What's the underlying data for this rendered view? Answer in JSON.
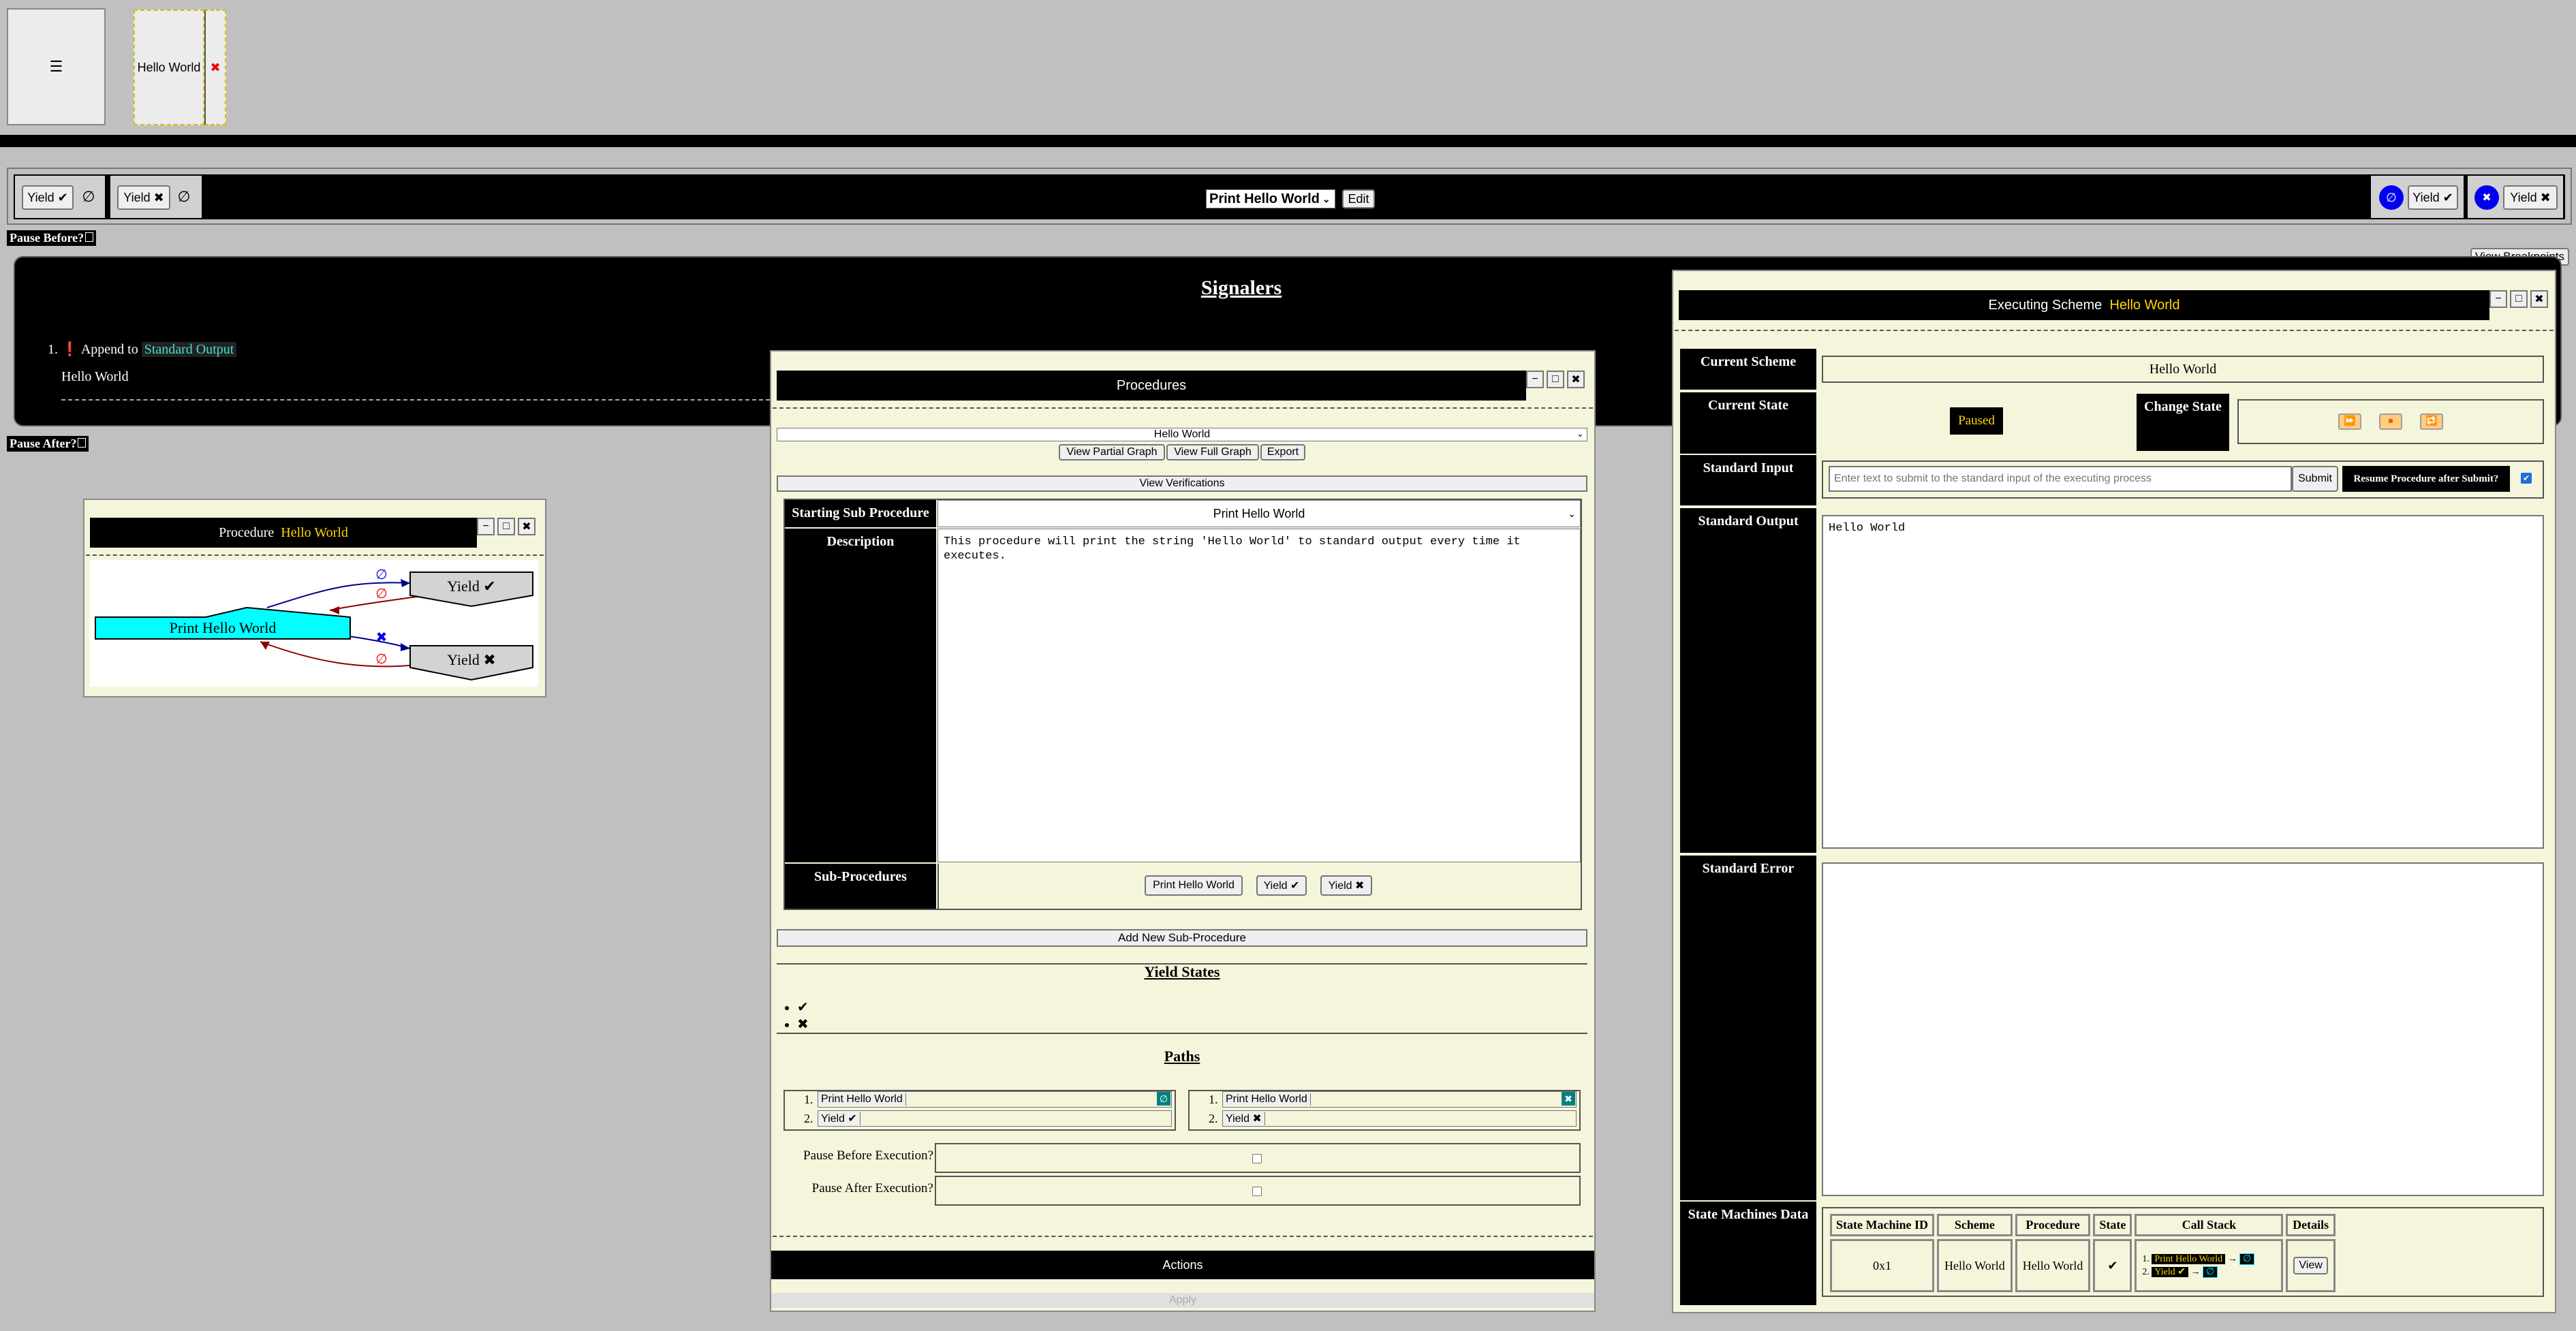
{
  "top": {
    "menu_icon": "☰",
    "tab_label": "Hello World",
    "tab_close": "✖"
  },
  "toolbar": {
    "left_items": [
      {
        "label": "Yield ✔",
        "icon": "∅"
      },
      {
        "label": "Yield ✖",
        "icon": "∅"
      }
    ],
    "procedure_select": "Print Hello World",
    "edit_label": "Edit",
    "right_items": [
      {
        "label": "Yield ✔",
        "icon": "∅"
      },
      {
        "label": "Yield ✖",
        "icon": "✖"
      }
    ]
  },
  "pause_before": "Pause Before?",
  "pause_after": "Pause After?",
  "view_breakpoints": "View Breakpoints",
  "signalers": {
    "title": "Signalers",
    "item_number": "1.",
    "item_marker": "❗",
    "item_prefix": "Append to",
    "item_target": "Standard Output",
    "item_text": "Hello World"
  },
  "procedure_window": {
    "title_prefix": "Procedure",
    "title_name": "Hello World",
    "graph": {
      "main_node": "Print Hello World",
      "yield_ok": "Yield ✔",
      "yield_err": "Yield ✖",
      "edge_null": "∅",
      "edge_err": "✖"
    }
  },
  "procedures_window": {
    "title": "Procedures",
    "scheme_select": "Hello World",
    "view_partial": "View Partial Graph",
    "view_full": "View Full Graph",
    "export": "Export",
    "view_verifications": "View Verifications",
    "starting_label": "Starting Sub Procedure",
    "starting_value": "Print Hello World",
    "description_label": "Description",
    "description_text": "This procedure will print the string 'Hello World' to standard output every time it executes.",
    "subprocedures_label": "Sub-Procedures",
    "subprocedures": [
      "Print Hello World",
      "Yield ✔",
      "Yield ✖"
    ],
    "add_subprocedure": "Add New Sub-Procedure",
    "yield_states_title": "Yield States",
    "yield_states": [
      "✔",
      "✖"
    ],
    "paths_title": "Paths",
    "path_left": {
      "row1": "Print Hello World",
      "row1_icon": "∅",
      "row2": "Yield ✔",
      "n1": "1.",
      "n2": "2."
    },
    "path_right": {
      "row1": "Print Hello World",
      "row1_icon": "✖",
      "row2": "Yield ✖",
      "n1": "1.",
      "n2": "2."
    },
    "pause_before_exec": "Pause Before Execution?",
    "pause_after_exec": "Pause After Execution?",
    "actions": "Actions",
    "apply": "Apply"
  },
  "executing_window": {
    "title_prefix": "Executing Scheme",
    "title_name": "Hello World",
    "current_scheme_label": "Current Scheme",
    "current_scheme_value": "Hello World",
    "current_state_label": "Current State",
    "state_value": "Paused",
    "change_state_label": "Change State",
    "standard_input_label": "Standard Input",
    "input_placeholder": "Enter text to submit to the standard input of the executing process",
    "submit": "Submit",
    "resume_label": "Resume Procedure after Submit?",
    "standard_output_label": "Standard Output",
    "standard_output_text": "Hello World",
    "standard_error_label": "Standard Error",
    "standard_error_text": "",
    "smd_label": "State Machines Data",
    "smd_headers": [
      "State Machine ID",
      "Scheme",
      "Procedure",
      "State",
      "Call Stack",
      "Details"
    ],
    "smd_row": {
      "id": "0x1",
      "scheme": "Hello World",
      "procedure": "Hello World",
      "state": "✔",
      "stack1_num": "1.",
      "stack1": "Print Hello World",
      "stack2_num": "2.",
      "stack2": "Yield ✔",
      "stack_arrow": "→",
      "stack_icon": "∅",
      "view": "View"
    }
  },
  "window_buttons": {
    "min": "−",
    "max": "□",
    "close": "✖"
  }
}
